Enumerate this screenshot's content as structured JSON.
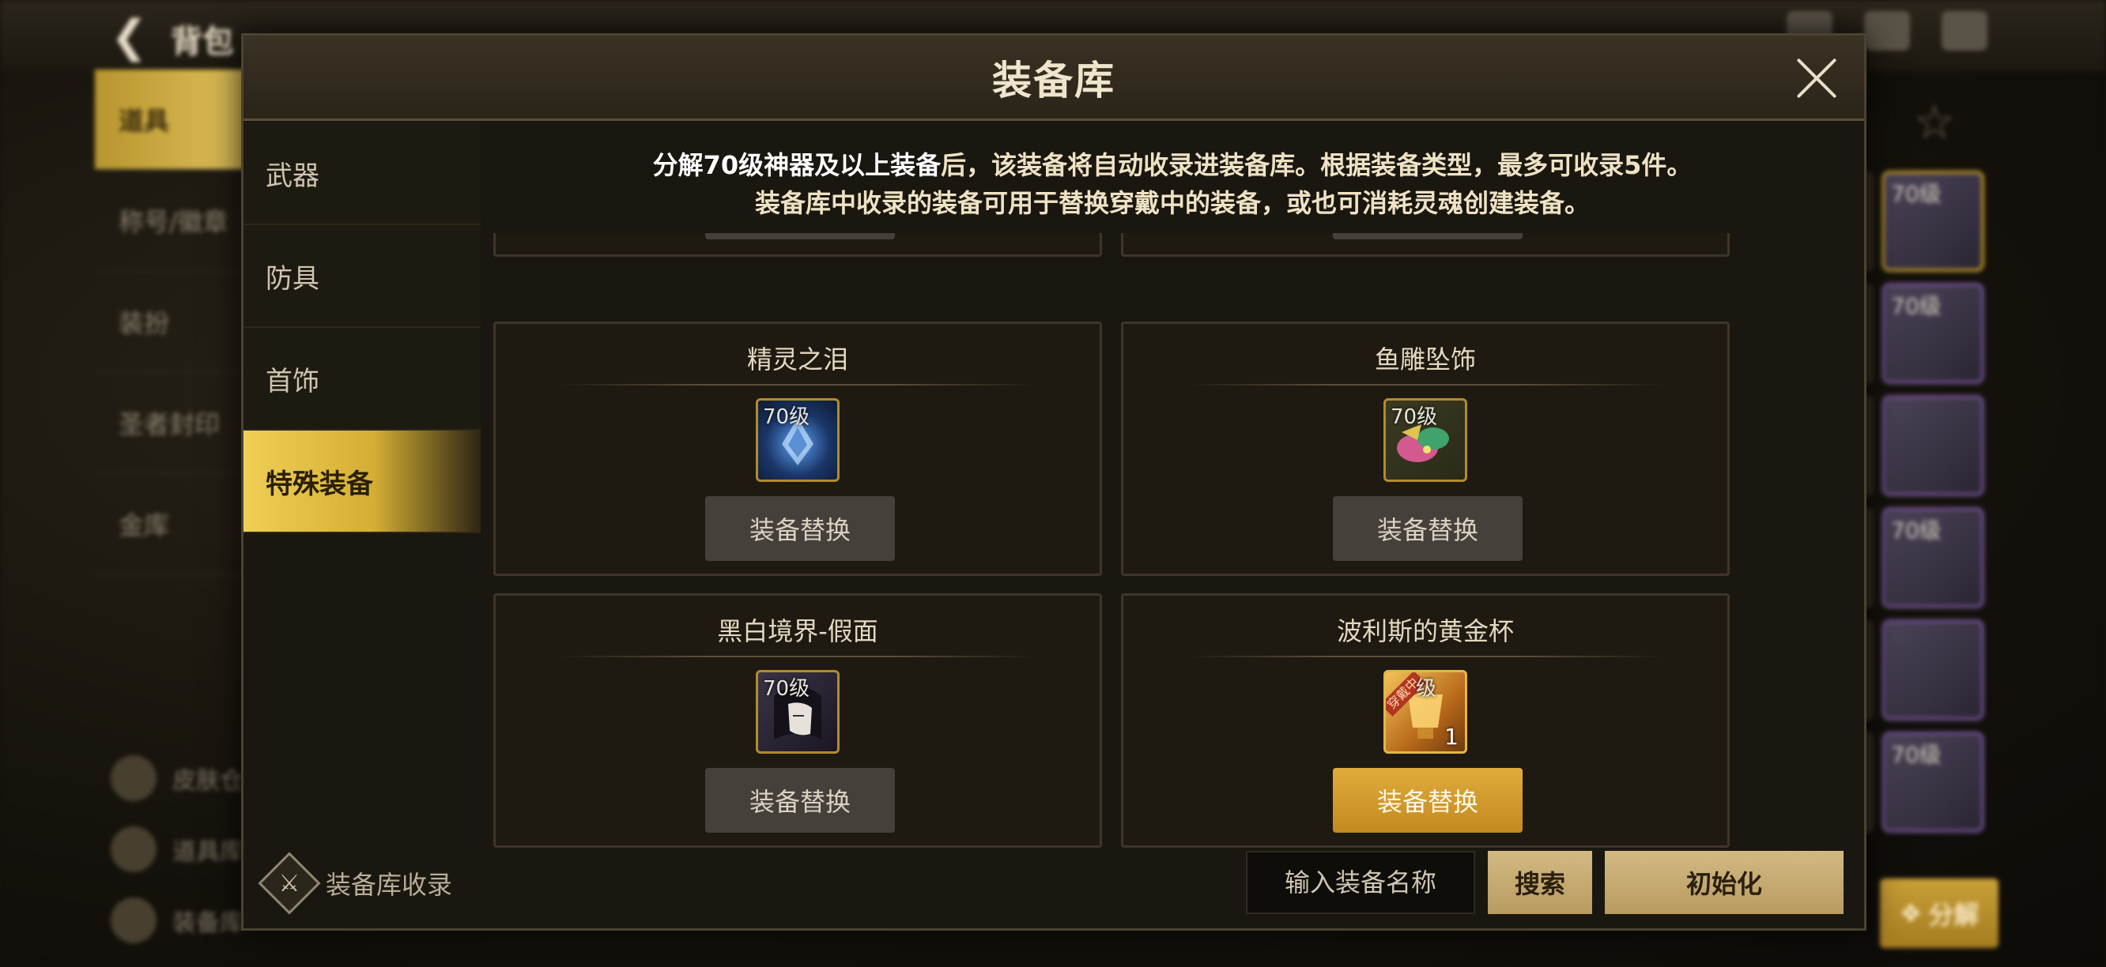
{
  "background": {
    "title": "背包",
    "nav_items": [
      "道具",
      "称号/徽章",
      "装扮",
      "圣者封印",
      "金库"
    ],
    "bottom_items": [
      "皮肤仓",
      "道具库",
      "装备库"
    ],
    "cell_level": "70级",
    "decompose_label": "分解"
  },
  "modal": {
    "title": "装备库",
    "close_icon": "close-icon"
  },
  "tabs": [
    {
      "label": "武器",
      "active": false
    },
    {
      "label": "防具",
      "active": false
    },
    {
      "label": "首饰",
      "active": false
    },
    {
      "label": "特殊装备",
      "active": true
    }
  ],
  "notice": {
    "line1_part1": "分解70级神器及以上装备",
    "line1_part2": "后，该装备将自动收录进装备库。根据装备类型，最多可收录5件。",
    "line2": "装备库中收录的装备可用于替换穿戴中的装备，或也可消耗灵魂创建装备。"
  },
  "cards": [
    {
      "name": "精灵之泪",
      "level": "70级",
      "button": "装备替换",
      "active": false,
      "icon": "teardrop-gem-icon"
    },
    {
      "name": "鱼雕坠饰",
      "level": "70级",
      "button": "装备替换",
      "active": false,
      "icon": "fish-pendant-icon"
    },
    {
      "name": "黑白境界-假面",
      "level": "70级",
      "button": "装备替换",
      "active": false,
      "icon": "mask-icon"
    },
    {
      "name": "波利斯的黄金杯",
      "level": "级",
      "count": "1",
      "equipped_tag": "穿戴中",
      "button": "装备替换",
      "active": true,
      "icon": "golden-cup-icon"
    }
  ],
  "footer": {
    "collect_label": "装备库收录",
    "search_placeholder": "输入装备名称",
    "search_label": "搜索",
    "reset_label": "初始化"
  },
  "colors": {
    "accent_gold": "#d5ae34",
    "active_button": "#c38a1f",
    "panel_bg": "#1a1710"
  }
}
